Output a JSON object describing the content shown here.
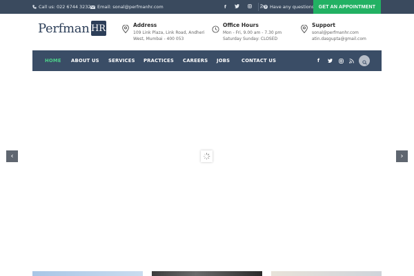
{
  "topbar": {
    "phone": "Call us: 022 6744 3232",
    "email": "Email: sonal@perfmanhr.com",
    "social_icons": [
      "facebook-icon",
      "twitter-icon",
      "instagram-icon",
      "rss-icon"
    ],
    "question": "Have any questions",
    "appointment_label": "GET AN APPOINTMENT"
  },
  "logo": {
    "word": "Perfman",
    "mark": "HR"
  },
  "info": {
    "address": {
      "title": "Address",
      "line1": "109 Link Plaza, Link Road, Andheri",
      "line2": "West, Mumbai - 400 053"
    },
    "hours": {
      "title": "Office Hours",
      "line1": "Mon - Fri, 9.00 am - 7.30 pm",
      "line2": "Saturday Sunday: CLOSED"
    },
    "support": {
      "title": "Support",
      "line1": "sonal@perfmanhr.com",
      "line2": "atin.dasgupta@gmail.com"
    }
  },
  "nav": {
    "items": [
      "HOME",
      "ABOUT US",
      "SERVICES",
      "PRACTICES",
      "CAREERS",
      "JOBS",
      "CONTACT US"
    ],
    "active": "HOME"
  },
  "slider": {
    "prev_glyph": "‹",
    "next_glyph": "›"
  },
  "colors": {
    "topbar": "#3a4a5e",
    "nav": "#3a4d66",
    "accent": "#22b163",
    "active_nav": "#4cd08a",
    "brand": "#2c3e58"
  }
}
